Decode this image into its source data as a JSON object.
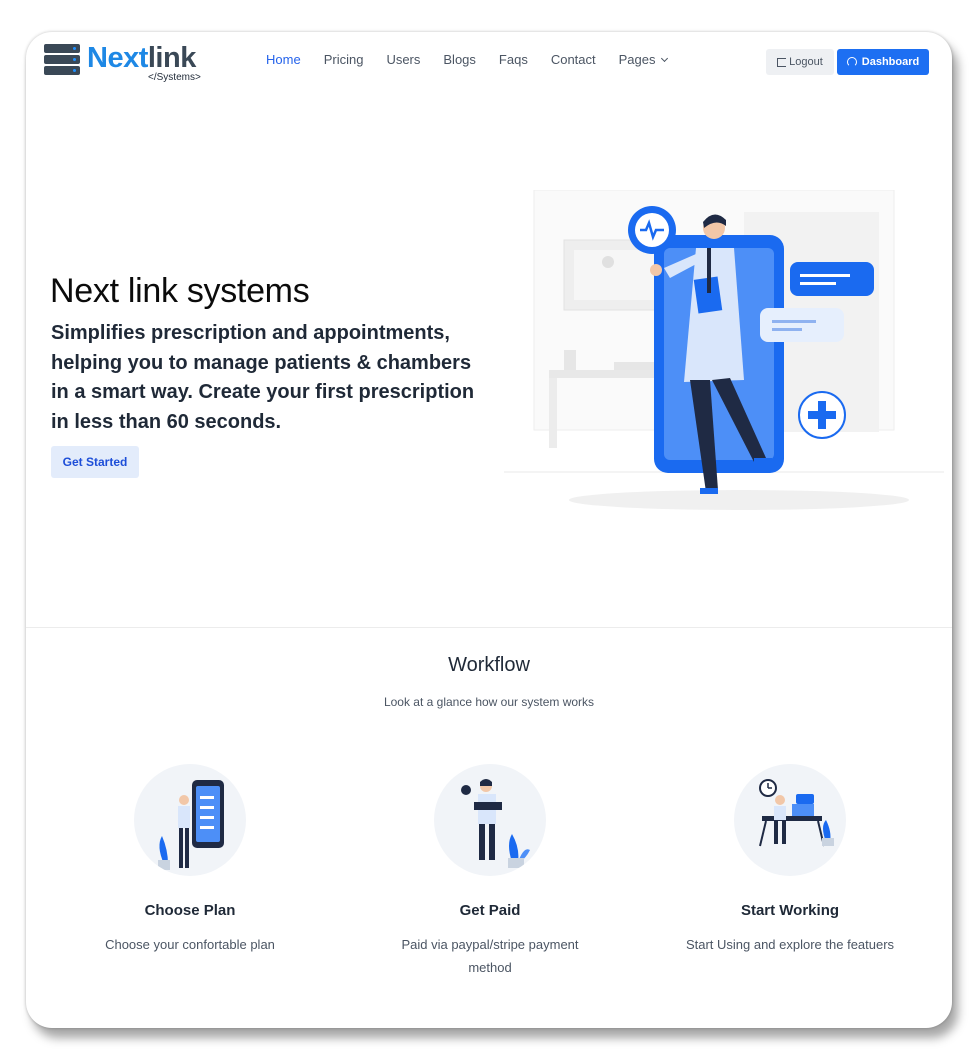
{
  "brand": {
    "name_part1": "Next",
    "name_part2": "link",
    "subtitle": "</Systems>"
  },
  "nav": {
    "items": [
      {
        "label": "Home",
        "active": true
      },
      {
        "label": "Pricing",
        "active": false
      },
      {
        "label": "Users",
        "active": false
      },
      {
        "label": "Blogs",
        "active": false
      },
      {
        "label": "Faqs",
        "active": false
      },
      {
        "label": "Contact",
        "active": false
      },
      {
        "label": "Pages",
        "active": false,
        "dropdown": true
      }
    ],
    "logout_label": "Logout",
    "dashboard_label": "Dashboard"
  },
  "hero": {
    "title": "Next link systems",
    "text": "Simplifies prescription and appointments, helping you to manage patients & chambers in a smart way. Create your first prescription in less than 60 seconds.",
    "cta_label": "Get Started"
  },
  "workflow": {
    "title": "Workflow",
    "subtitle": "Look at a glance how our system works",
    "steps": [
      {
        "name": "Choose Plan",
        "desc": "Choose your confortable plan"
      },
      {
        "name": "Get Paid",
        "desc": "Paid via paypal/stripe payment method"
      },
      {
        "name": "Start Working",
        "desc": "Start Using and explore the featuers"
      }
    ]
  },
  "colors": {
    "primary": "#1d6ff2",
    "accent": "#1e88e5",
    "dark": "#3a4856"
  }
}
